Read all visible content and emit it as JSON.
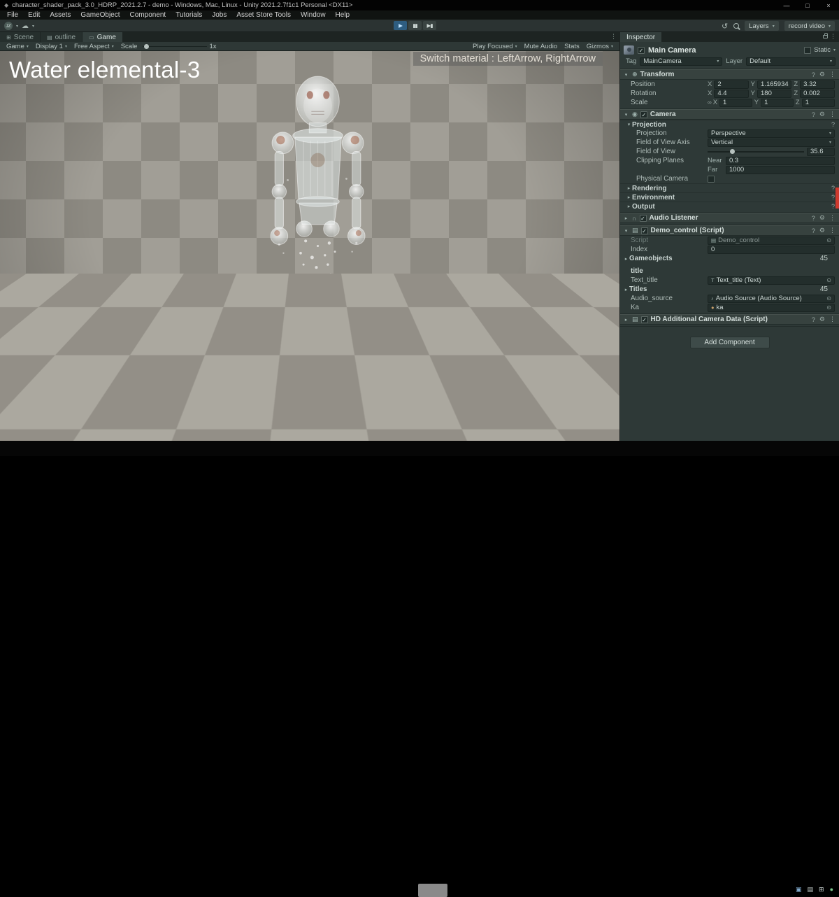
{
  "window": {
    "title": "character_shader_pack_3.0_HDRP_2021.2.7 - demo - Windows, Mac, Linux - Unity 2021.2.7f1c1 Personal <DX11>"
  },
  "menu": {
    "items": [
      "File",
      "Edit",
      "Assets",
      "GameObject",
      "Component",
      "Tutorials",
      "Jobs",
      "Asset Store Tools",
      "Window",
      "Help"
    ]
  },
  "toolbar": {
    "account": "JZ",
    "layers": "Layers",
    "layout": "record video"
  },
  "left_tabs": {
    "scene": "Scene",
    "outline": "outline",
    "game": "Game"
  },
  "game_toolbar": {
    "game": "Game",
    "display": "Display 1",
    "aspect": "Free Aspect",
    "scale_label": "Scale",
    "scale_value": "1x",
    "play_focused": "Play Focused",
    "mute_audio": "Mute Audio",
    "stats": "Stats",
    "gizmos": "Gizmos"
  },
  "game_view": {
    "title": "Water elemental-3",
    "hint": "Switch material : LeftArrow, RightArrow"
  },
  "inspector": {
    "tab": "Inspector",
    "header": {
      "name": "Main Camera",
      "static_label": "Static",
      "tag_label": "Tag",
      "tag_value": "MainCamera",
      "layer_label": "Layer",
      "layer_value": "Default"
    },
    "transform": {
      "title": "Transform",
      "axis": {
        "x": "X",
        "y": "Y",
        "z": "Z"
      },
      "position": {
        "label": "Position",
        "x": "2",
        "y": "1.165934",
        "z": "3.32"
      },
      "rotation": {
        "label": "Rotation",
        "x": "4.4",
        "y": "180",
        "z": "0.002"
      },
      "scale": {
        "label": "Scale",
        "x": "1",
        "y": "1",
        "z": "1"
      }
    },
    "camera": {
      "title": "Camera",
      "projection_section": "Projection",
      "projection_label": "Projection",
      "projection_value": "Perspective",
      "fov_axis_label": "Field of View Axis",
      "fov_axis_value": "Vertical",
      "fov_label": "Field of View",
      "fov_value": "35.6",
      "clipping_label": "Clipping Planes",
      "near_label": "Near",
      "near_value": "0.3",
      "far_label": "Far",
      "far_value": "1000",
      "physical_label": "Physical Camera",
      "rendering": "Rendering",
      "environment": "Environment",
      "output": "Output"
    },
    "audio_listener": {
      "title": "Audio Listener"
    },
    "demo_control": {
      "title": "Demo_control (Script)",
      "script_label": "Script",
      "script_value": "Demo_control",
      "index_label": "Index",
      "index_value": "0",
      "gameobjects_label": "Gameobjects",
      "gameobjects_count": "45",
      "section_title": "title",
      "text_title_label": "Text_title",
      "text_title_value": "Text_title (Text)",
      "titles_label": "Titles",
      "titles_count": "45",
      "audio_source_label": "Audio_source",
      "audio_source_value": "Audio Source (Audio Source)",
      "ka_label": "Ka",
      "ka_value": "ka"
    },
    "hd_camera": {
      "title": "HD Additional Camera Data (Script)"
    },
    "add_component": "Add Component"
  },
  "icons": {
    "unity_logo": "◆",
    "minimize": "—",
    "maximize": "□",
    "close": "×",
    "caret_down": "▾",
    "caret_right": "▸",
    "check": "✓",
    "kebab": "⋮",
    "help": "?",
    "gear": "⚙",
    "play": "▶",
    "pause": "▮▮",
    "step": "▶▮",
    "cloud": "☁",
    "history": "↺",
    "picker": "⊙",
    "link": "∞",
    "scene_tab": "⊞",
    "outline_tab": "▤",
    "game_tab": "▭",
    "transform": "⊕",
    "camera": "◉",
    "audio": "∩",
    "script": "▤",
    "note": "♪",
    "text": "T",
    "dot": "●",
    "prev": "‹",
    "next": "›",
    "tray1": "▣",
    "tray2": "▤",
    "tray3": "⊞",
    "tray4": "●"
  }
}
